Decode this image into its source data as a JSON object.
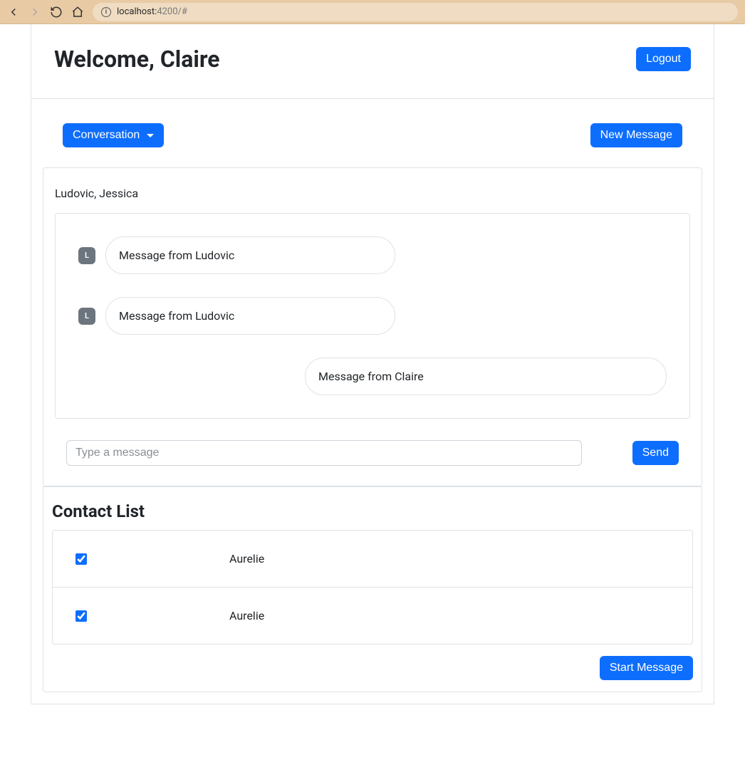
{
  "browser": {
    "url_host": "localhost:",
    "url_rest": "4200/#"
  },
  "header": {
    "welcome": "Welcome, Claire",
    "logout": "Logout"
  },
  "toolbar": {
    "conversation_label": "Conversation",
    "new_message_label": "New Message"
  },
  "conversation": {
    "participants": "Ludovic, Jessica",
    "messages": [
      {
        "initial": "L",
        "text": "Message from Ludovic",
        "side": "left"
      },
      {
        "initial": "L",
        "text": "Message from Ludovic",
        "side": "left"
      },
      {
        "text": "Message from Claire",
        "side": "right"
      }
    ],
    "compose_placeholder": "Type a message",
    "send_label": "Send"
  },
  "contacts": {
    "title": "Contact List",
    "items": [
      {
        "name": "Aurelie",
        "checked": true
      },
      {
        "name": "Aurelie",
        "checked": true
      }
    ],
    "start_label": "Start Message"
  }
}
